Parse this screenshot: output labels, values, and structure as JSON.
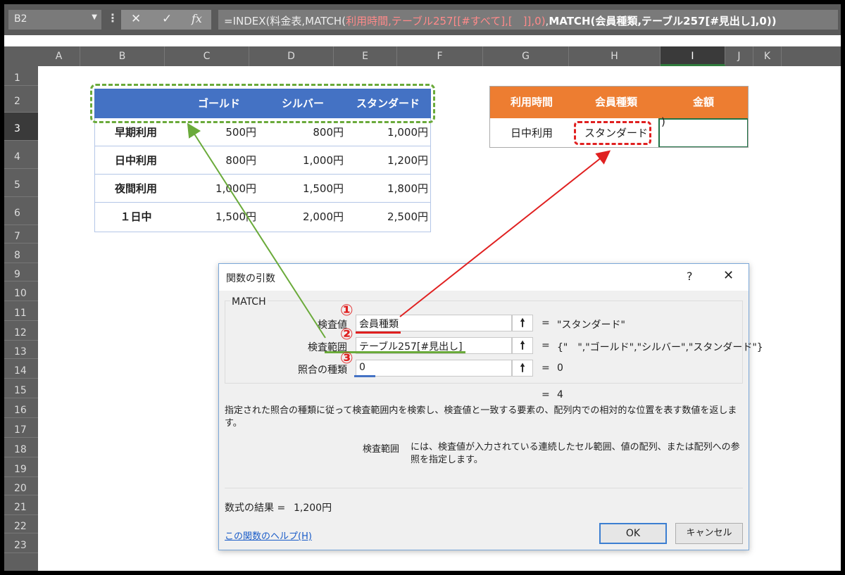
{
  "formula_bar": {
    "name_box": "B2",
    "cancel_icon": "✕",
    "enter_icon": "✓",
    "fx_label": "fx",
    "formula_part1": "=INDEX(料金表,MATCH(",
    "formula_part2": "利用時間,テーブル257[[#すべて],[　]],0)",
    "formula_part3": ",",
    "formula_part4": "MATCH(会員種類,テーブル257[#見出し],0))"
  },
  "columns": [
    "A",
    "B",
    "C",
    "D",
    "E",
    "F",
    "G",
    "H",
    "I",
    "J",
    "K"
  ],
  "selected_column": "I",
  "rows": [
    "1",
    "2",
    "3",
    "4",
    "5",
    "6",
    "7",
    "8",
    "9",
    "10",
    "11",
    "12",
    "13",
    "14",
    "15",
    "16",
    "17",
    "18",
    "19",
    "20",
    "21",
    "22",
    "23"
  ],
  "selected_row": "3",
  "pricing_table": {
    "headers": [
      "",
      "ゴールド",
      "シルバー",
      "スタンダード"
    ],
    "rows": [
      {
        "label": "早期利用",
        "values": [
          "500円",
          "800円",
          "1,000円"
        ]
      },
      {
        "label": "日中利用",
        "values": [
          "800円",
          "1,000円",
          "1,200円"
        ]
      },
      {
        "label": "夜間利用",
        "values": [
          "1,000円",
          "1,500円",
          "1,800円"
        ]
      },
      {
        "label": "１日中",
        "values": [
          "1,500円",
          "2,000円",
          "2,500円"
        ]
      }
    ]
  },
  "lookup_table": {
    "headers": [
      "利用時間",
      "会員種類",
      "金額"
    ],
    "usage_time": "日中利用",
    "member_type": "スタンダード",
    "amount_cell": ")"
  },
  "dialog": {
    "title": "関数の引数",
    "help_icon": "?",
    "close_icon": "✕",
    "function_name": "MATCH",
    "args": [
      {
        "label": "検査値",
        "value": "会員種類",
        "result": "\"スタンダード\"",
        "marker": "①"
      },
      {
        "label": "検査範囲",
        "value": "テーブル257[#見出し]",
        "result": "{\"　\",\"ゴールド\",\"シルバー\",\"スタンダード\"}",
        "marker": "②"
      },
      {
        "label": "照合の種類",
        "value": "0",
        "result": "0",
        "marker": "③"
      }
    ],
    "ref_button_icon": "🠕",
    "equals": "=",
    "function_result": "4",
    "description": "指定された照合の種類に従って検査範囲内を検索し、検査値と一致する要素の、配列内での相対的な位置を表す数値を返します。",
    "arg_name": "検査範囲",
    "arg_description": "には、検査値が入力されている連続したセル範囲、値の配列、または配列への参照を指定します。",
    "formula_result_label": "数式の結果 =",
    "formula_result_value": "1,200円",
    "help_link": "この関数のヘルプ(H)",
    "ok_label": "OK",
    "cancel_label": "キャンセル"
  },
  "colors": {
    "table_header_blue": "#4472c4",
    "lookup_header_orange": "#ed7d31",
    "marker_red": "#e02020",
    "arrow_green": "#6aaa3a",
    "underline_blue": "#4472c4"
  }
}
